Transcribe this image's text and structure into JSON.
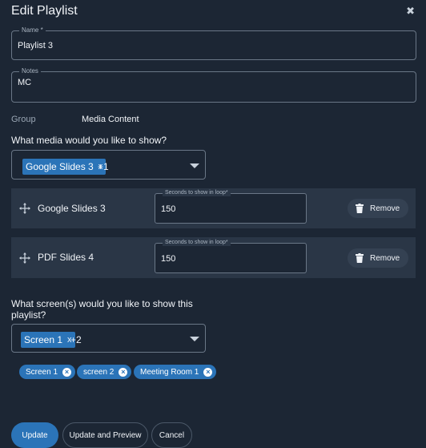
{
  "dialog": {
    "title": "Edit Playlist",
    "close_glyph": "✖"
  },
  "name_field": {
    "label": "Name *",
    "value": "Playlist 3"
  },
  "notes_field": {
    "label": "Notes",
    "value": "MC"
  },
  "group": {
    "label": "Group",
    "value": "Media Content"
  },
  "media_question": "What media would you like to show?",
  "media_select": {
    "chip": "Google Slides 3",
    "chip_remove": "x",
    "more": "+1"
  },
  "media_items": [
    {
      "name": "Google Slides 3",
      "seconds_label": "Seconds to show in loop*",
      "seconds": "150",
      "remove_label": "Remove"
    },
    {
      "name": "PDF Slides 4",
      "seconds_label": "Seconds to show in loop*",
      "seconds": "150",
      "remove_label": "Remove"
    }
  ],
  "screens_question": "What screen(s) would you like to show this playlist?",
  "screens_select": {
    "chip": "Screen 1",
    "chip_remove": "x",
    "more": "+2"
  },
  "screen_tags": [
    {
      "label": "Screen 1",
      "remove_glyph": "×"
    },
    {
      "label": "screen 2",
      "remove_glyph": "×"
    },
    {
      "label": "Meeting Room 1",
      "remove_glyph": "×"
    }
  ],
  "actions": {
    "update": "Update",
    "update_preview": "Update and Preview",
    "cancel": "Cancel"
  },
  "colors": {
    "background": "#1c2634",
    "accent": "#2b74b8",
    "row": "#2a3646"
  }
}
